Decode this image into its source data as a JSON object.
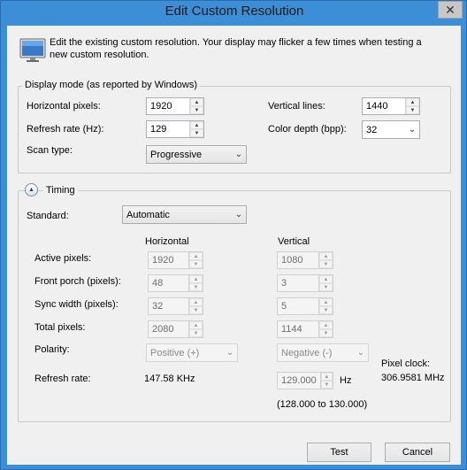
{
  "window": {
    "title": "Edit Custom Resolution",
    "close_glyph": "✕"
  },
  "info": {
    "text": "Edit the existing custom resolution. Your display may flicker a few times when testing a new custom resolution."
  },
  "display_mode": {
    "group_label": "Display mode (as reported by Windows)",
    "horizontal_label": "Horizontal pixels:",
    "horizontal_value": "1920",
    "vertical_label": "Vertical lines:",
    "vertical_value": "1440",
    "refresh_label": "Refresh rate (Hz):",
    "refresh_value": "129",
    "color_label": "Color depth (bpp):",
    "color_value": "32",
    "scan_label": "Scan type:",
    "scan_value": "Progressive"
  },
  "timing": {
    "expander_label": "Timing",
    "standard_label": "Standard:",
    "standard_value": "Automatic",
    "col_horizontal": "Horizontal",
    "col_vertical": "Vertical",
    "rows": [
      {
        "label": "Active pixels:",
        "h": "1920",
        "v": "1080"
      },
      {
        "label": "Front porch (pixels):",
        "h": "48",
        "v": "3"
      },
      {
        "label": "Sync width (pixels):",
        "h": "32",
        "v": "5"
      },
      {
        "label": "Total pixels:",
        "h": "2080",
        "v": "1144"
      }
    ],
    "polarity_label": "Polarity:",
    "polarity_h": "Positive (+)",
    "polarity_v": "Negative (-)",
    "refresh_label": "Refresh rate:",
    "refresh_h": "147.58 KHz",
    "refresh_v": "129.000",
    "refresh_unit": "Hz",
    "refresh_range": "(128.000 to 130.000)",
    "pixel_clock_label": "Pixel clock:",
    "pixel_clock_value": "306.9581 MHz"
  },
  "buttons": {
    "test": "Test",
    "cancel": "Cancel"
  },
  "icons": {
    "spin_up": "▲",
    "spin_down": "▼",
    "combo_caret": "⌄",
    "expander": "▲"
  },
  "colors": {
    "titlebar": "#3c8ed6",
    "client": "#f0f0f0"
  }
}
